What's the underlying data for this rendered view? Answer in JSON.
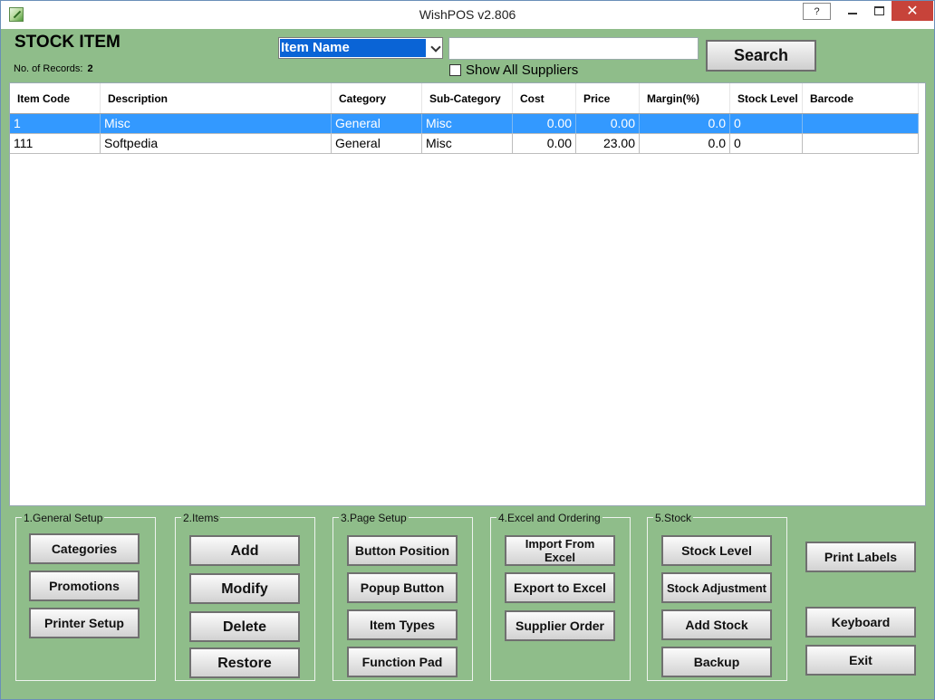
{
  "window": {
    "title": "WishPOS v2.806",
    "help_label": "?",
    "close_label": "✕"
  },
  "header": {
    "title": "STOCK ITEM",
    "records_label": "No. of Records:",
    "records_count": "2"
  },
  "search": {
    "field_selected": "Item Name",
    "input_value": "",
    "show_all_suppliers_label": "Show All Suppliers",
    "show_all_suppliers_checked": false,
    "button_label": "Search"
  },
  "table": {
    "columns": [
      "Item Code",
      "Description",
      "Category",
      "Sub-Category",
      "Cost",
      "Price",
      "Margin(%)",
      "Stock Level",
      "Barcode"
    ],
    "rows": [
      [
        "1",
        "Misc",
        "General",
        "Misc",
        "0.00",
        "0.00",
        "0.0",
        "0",
        ""
      ],
      [
        "111",
        "Softpedia",
        "General",
        "Misc",
        "0.00",
        "23.00",
        "0.0",
        "0",
        ""
      ]
    ],
    "selected_row": 0
  },
  "groups": {
    "general_setup": {
      "label": "1.General Setup",
      "buttons": [
        "Categories",
        "Promotions",
        "Printer Setup"
      ]
    },
    "items": {
      "label": "2.Items",
      "buttons": [
        "Add",
        "Modify",
        "Delete",
        "Restore"
      ]
    },
    "page_setup": {
      "label": "3.Page Setup",
      "buttons": [
        "Button Position",
        "Popup Button",
        "Item Types",
        "Function Pad"
      ]
    },
    "excel_ordering": {
      "label": "4.Excel and Ordering",
      "buttons": [
        "Import From Excel",
        "Export to Excel",
        "Supplier Order"
      ]
    },
    "stock": {
      "label": "5.Stock",
      "buttons": [
        "Stock Level",
        "Stock Adjustment",
        "Add Stock",
        "Backup"
      ]
    }
  },
  "side_buttons": {
    "print_labels": "Print Labels",
    "keyboard": "Keyboard",
    "exit": "Exit"
  },
  "colors": {
    "window_bg": "#8fbd8a",
    "selection": "#3399ff",
    "close_button": "#c7433a"
  }
}
